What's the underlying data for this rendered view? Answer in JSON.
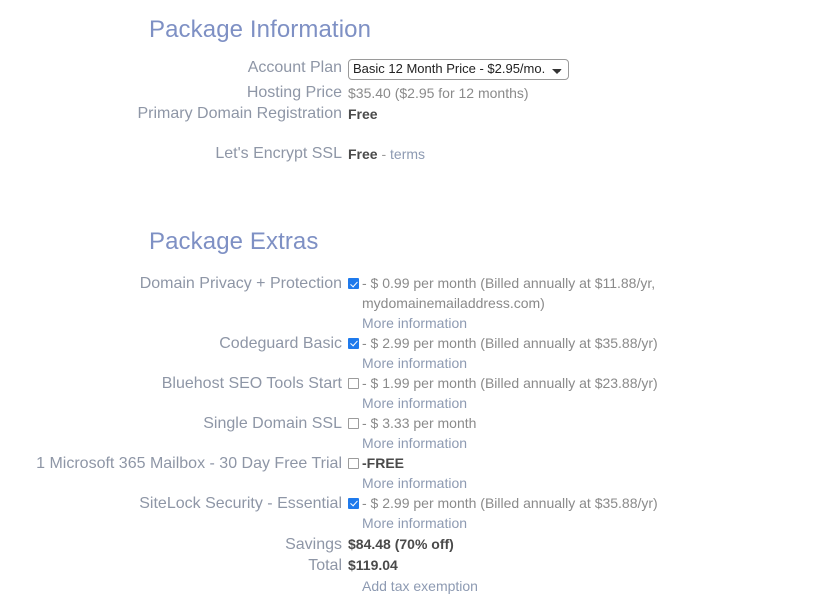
{
  "package_information": {
    "title": "Package Information",
    "rows": [
      {
        "label": "Account Plan",
        "type": "select",
        "selected": "Basic 12 Month Price - $2.95/mo.",
        "options": [
          "Basic 12 Month Price - $2.95/mo."
        ]
      },
      {
        "label": "Hosting Price",
        "type": "text",
        "value": "$35.40  ($2.95 for 12 months)"
      },
      {
        "label": "Primary Domain Registration",
        "type": "strong",
        "value": "Free"
      },
      {
        "label": "Let's Encrypt SSL",
        "type": "strong_link",
        "value": "Free",
        "separator": " - ",
        "link": "terms"
      }
    ]
  },
  "package_extras": {
    "title": "Package Extras",
    "items": [
      {
        "label": "Domain Privacy + Protection",
        "checked": true,
        "price_text": "- $ 0.99 per month (Billed annually at $11.88/yr, mydomainemailaddress.com)",
        "more_info": "More information"
      },
      {
        "label": "Codeguard Basic",
        "checked": true,
        "price_text": "- $ 2.99 per month (Billed annually at $35.88/yr)",
        "more_info": "More information"
      },
      {
        "label": "Bluehost SEO Tools Start",
        "checked": false,
        "price_text": "- $ 1.99 per month (Billed annually at $23.88/yr)",
        "more_info": "More information"
      },
      {
        "label": "Single Domain SSL",
        "checked": false,
        "price_text": "- $ 3.33 per month",
        "more_info": "More information"
      },
      {
        "label": "1 Microsoft 365 Mailbox - 30 Day Free Trial",
        "checked": false,
        "price_text": "-FREE",
        "price_bold": true,
        "more_info": "More information"
      },
      {
        "label": "SiteLock Security - Essential",
        "checked": true,
        "price_text": "- $ 2.99 per month (Billed annually at $35.88/yr)",
        "more_info": "More information"
      }
    ],
    "savings_label": "Savings",
    "savings_value": "$84.48 (70% off)",
    "total_label": "Total",
    "total_value": "$119.04",
    "tax_exemption_link": "Add tax exemption"
  },
  "colors": {
    "heading": "#7e90c4",
    "label": "#8e96a6",
    "link": "#8d9ab2",
    "value": "#8a8a8a",
    "strong": "#4a4a4a",
    "checkbox_checked": "#1f7aec"
  }
}
